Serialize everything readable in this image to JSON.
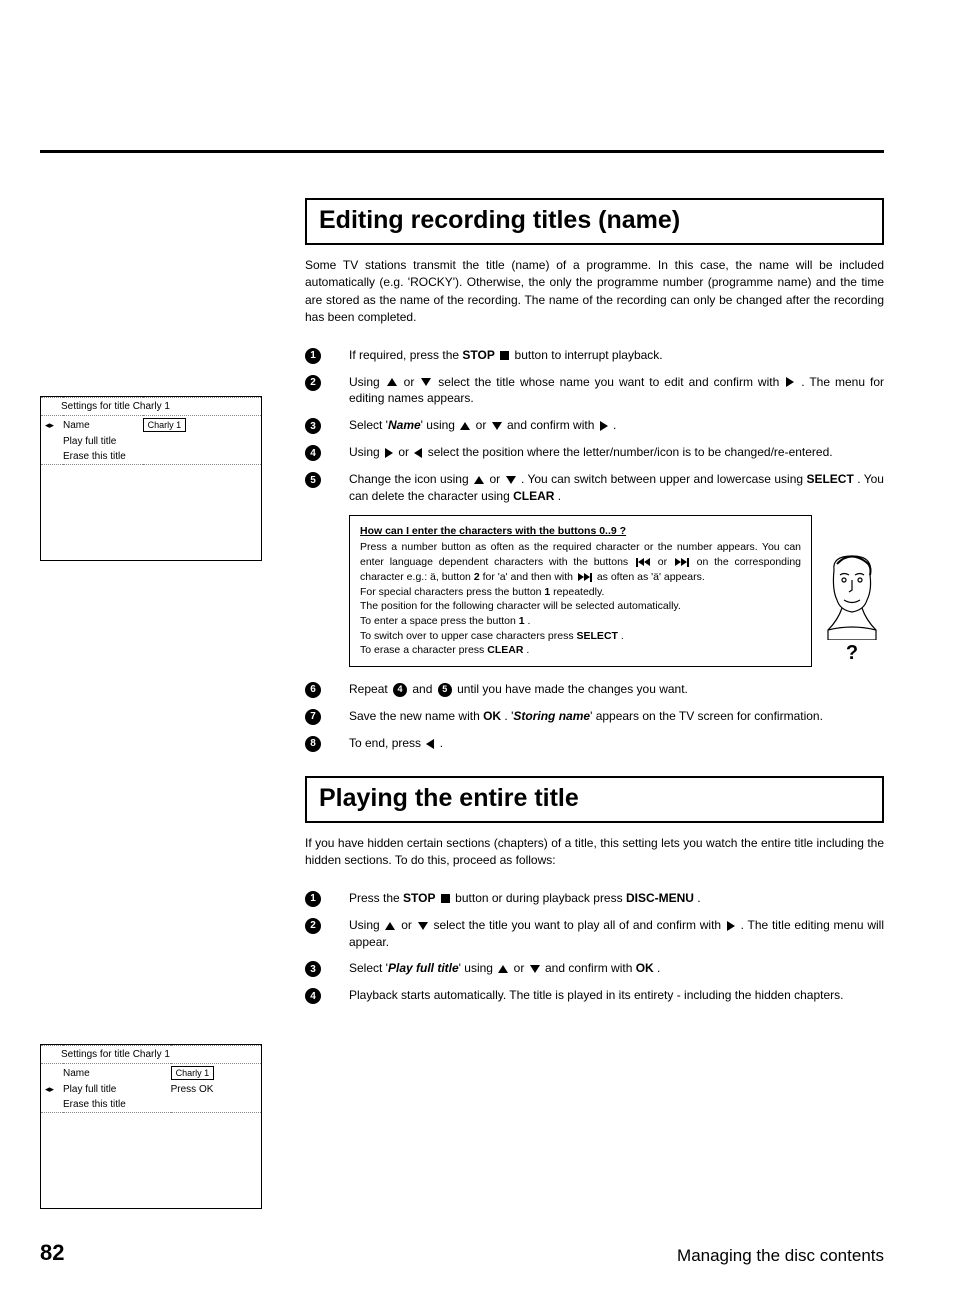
{
  "sections": {
    "edit": {
      "title": "Editing recording titles (name)",
      "intro": "Some TV stations transmit the title (name) of a programme. In this case, the name will be included automatically (e.g. 'ROCKY'). Otherwise, the only the programme number (programme name) and the time are stored as the name of the recording. The name of the recording can only be changed after the recording has been completed.",
      "osd": {
        "header": "Settings for title Charly 1",
        "row1_label": "Name",
        "row1_value": "Charly 1",
        "row2": "Play full title",
        "row3": "Erase this title"
      },
      "steps": {
        "s1_a": "If required, press the ",
        "s1_stop": "STOP",
        "s1_b": " button to interrupt playback.",
        "s2_a": "Using ",
        "s2_b": " or ",
        "s2_c": " select the title whose name you want to edit and confirm with ",
        "s2_d": " . The menu for editing names appears.",
        "s3_a": "Select '",
        "s3_name": "Name",
        "s3_b": "' using ",
        "s3_c": " or ",
        "s3_d": " and confirm with ",
        "s3_e": " .",
        "s4_a": "Using ",
        "s4_b": " or ",
        "s4_c": " select the position where the letter/number/icon is to be changed/re-entered.",
        "s5_a": "Change the icon using ",
        "s5_b": " or ",
        "s5_c": " . You can switch between upper and lowercase using ",
        "s5_select": "SELECT",
        "s5_d": " . You can delete the character using ",
        "s5_clear": "CLEAR",
        "s5_e": " .",
        "s6_a": "Repeat ",
        "s6_b": " and ",
        "s6_c": " until you have made the changes you want.",
        "s7_a": "Save the new name with ",
        "s7_ok": "OK",
        "s7_b": " . '",
        "s7_storing": "Storing name",
        "s7_c": "' appears on the TV screen for confirmation.",
        "s8_a": "To end, press ",
        "s8_b": " ."
      },
      "infobox": {
        "header": "How can I enter the characters with the buttons 0..9 ?",
        "l1": "Press a number button as often as the required character or the number appears. You can enter language dependent characters with the buttons",
        "l2a": " or ",
        "l2b": " on the corresponding character e.g.: ä, button ",
        "l2_two": "2",
        "l2c": " for 'a' and then with ",
        "l2d": " as often as 'ä' appears.",
        "l3a": "For special characters press the button ",
        "l3_one": "1",
        "l3b": " repeatedly.",
        "l4": "The position for the following character will be selected automatically.",
        "l5a": "To enter a space press the button ",
        "l5_one": "1",
        "l5b": " .",
        "l6a": "To switch over to upper case characters press ",
        "l6_select": "SELECT",
        "l6b": " .",
        "l7a": "To erase a character press ",
        "l7_clear": "CLEAR",
        "l7b": " .",
        "qmark": "?"
      }
    },
    "play": {
      "title": "Playing the entire title",
      "intro": "If you have hidden certain sections (chapters) of a title, this setting lets you watch the entire title including the hidden sections. To do this, proceed as follows:",
      "osd": {
        "header": "Settings for title Charly 1",
        "row1_label": "Name",
        "row1_value": "Charly 1",
        "row2_label": "Play full title",
        "row2_value": "Press OK",
        "row3": "Erase this title"
      },
      "steps": {
        "s1_a": "Press the ",
        "s1_stop": "STOP",
        "s1_b": " button or during playback press ",
        "s1_dm": "DISC-MENU",
        "s1_c": " .",
        "s2_a": "Using ",
        "s2_b": " or ",
        "s2_c": " select the title you want to play all of and confirm with ",
        "s2_d": " . The title editing menu will appear.",
        "s3_a": "Select '",
        "s3_pft": "Play full title",
        "s3_b": "' using ",
        "s3_c": " or ",
        "s3_d": " and confirm with ",
        "s3_ok": "OK",
        "s3_e": " .",
        "s4": "Playback starts automatically. The title is played in its entirety - including the hidden chapters."
      }
    }
  },
  "footer": {
    "page": "82",
    "chapter": "Managing the disc contents"
  }
}
